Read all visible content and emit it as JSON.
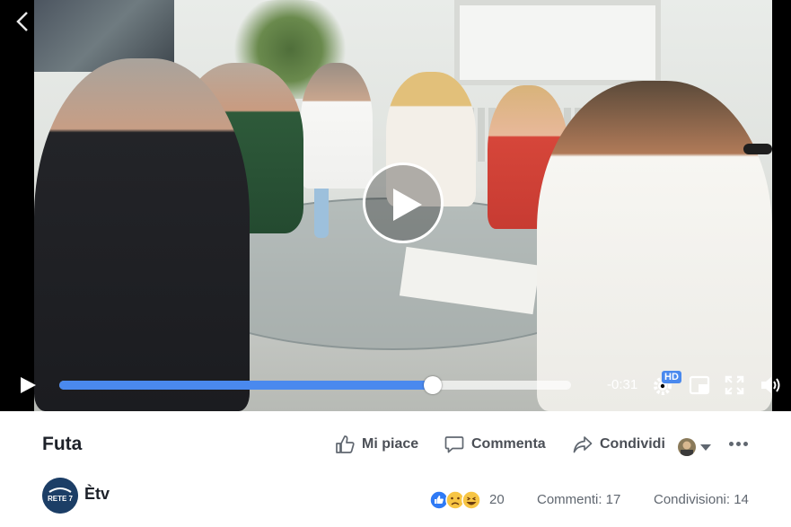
{
  "player": {
    "time_remaining": "-0:31",
    "hd_label": "HD",
    "progress_fraction": 0.73
  },
  "post": {
    "title": "Futa",
    "actions": {
      "like": "Mi piace",
      "comment": "Commenta",
      "share": "Condividi"
    },
    "page_name": "Ètv",
    "page_logo_text": "RETE 7",
    "reaction_count": "20",
    "comments": "Commenti: 17",
    "shares": "Condivisioni: 14"
  },
  "colors": {
    "accent": "#4a89ee",
    "text_primary": "#1d2129",
    "text_secondary": "#606770"
  },
  "icons": [
    "back-arrow-icon",
    "play-icon",
    "settings-icon",
    "pip-icon",
    "fullscreen-icon",
    "volume-icon",
    "like-icon",
    "comment-icon",
    "share-icon",
    "more-icon"
  ]
}
